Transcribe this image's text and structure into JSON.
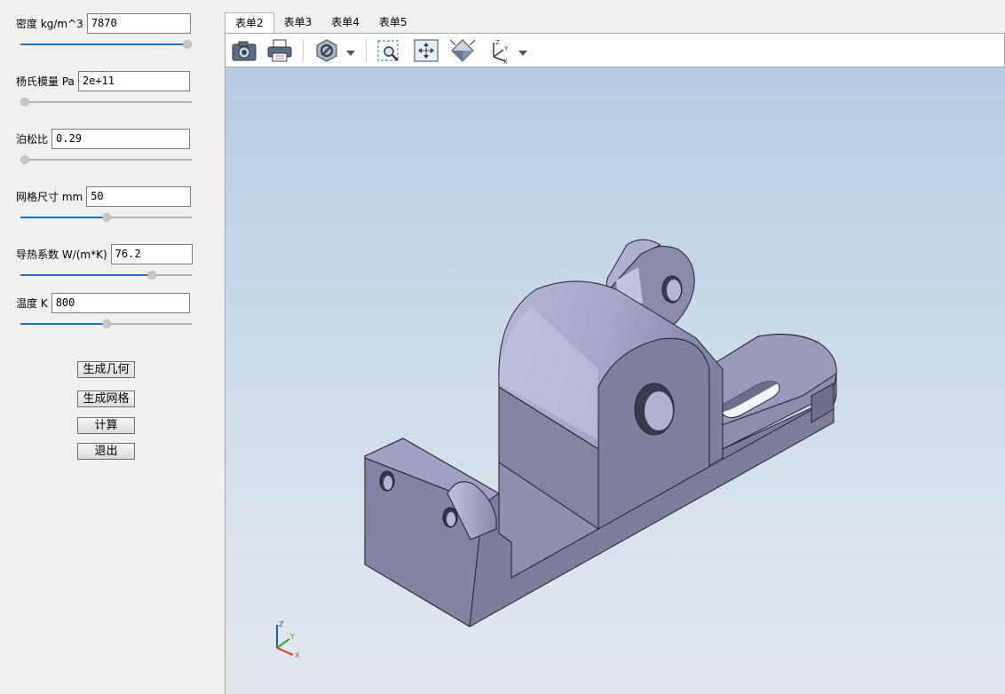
{
  "properties": [
    {
      "label": "密度 kg/m^3",
      "value": "7870",
      "slider_fraction": 1.0
    },
    {
      "label": "杨氏模量 Pa",
      "value": "2e+11",
      "slider_fraction": 0.0
    },
    {
      "label": "泊松比",
      "value": "0.29",
      "slider_fraction": 0.0
    },
    {
      "label": "网格尺寸 mm",
      "value": "50",
      "slider_fraction": 0.5
    },
    {
      "label": "导热系数 W/(m*K)",
      "value": "76.2",
      "slider_fraction": 0.78
    },
    {
      "label": "温度 K",
      "value": "800",
      "slider_fraction": 0.5
    }
  ],
  "buttons": {
    "generate_geometry": "生成几何",
    "generate_mesh": "生成网格",
    "compute": "计算",
    "exit": "退出"
  },
  "tabs": [
    "表单2",
    "表单3",
    "表单4",
    "表单5"
  ],
  "active_tab": "表单2",
  "toolbar": [
    "camera-icon",
    "print-icon",
    "render-mode-icon",
    "zoom-box-icon",
    "fit-all-icon",
    "view-iso-icon",
    "axes-orientation-icon"
  ],
  "triad": {
    "z": "Z",
    "y": "Y",
    "x": "X"
  },
  "colors": {
    "slider_fill": "#1c72c6",
    "model_face": "#8a8aa8",
    "viewport_top": "#b7cce3",
    "viewport_bottom": "#e3e8ef"
  }
}
